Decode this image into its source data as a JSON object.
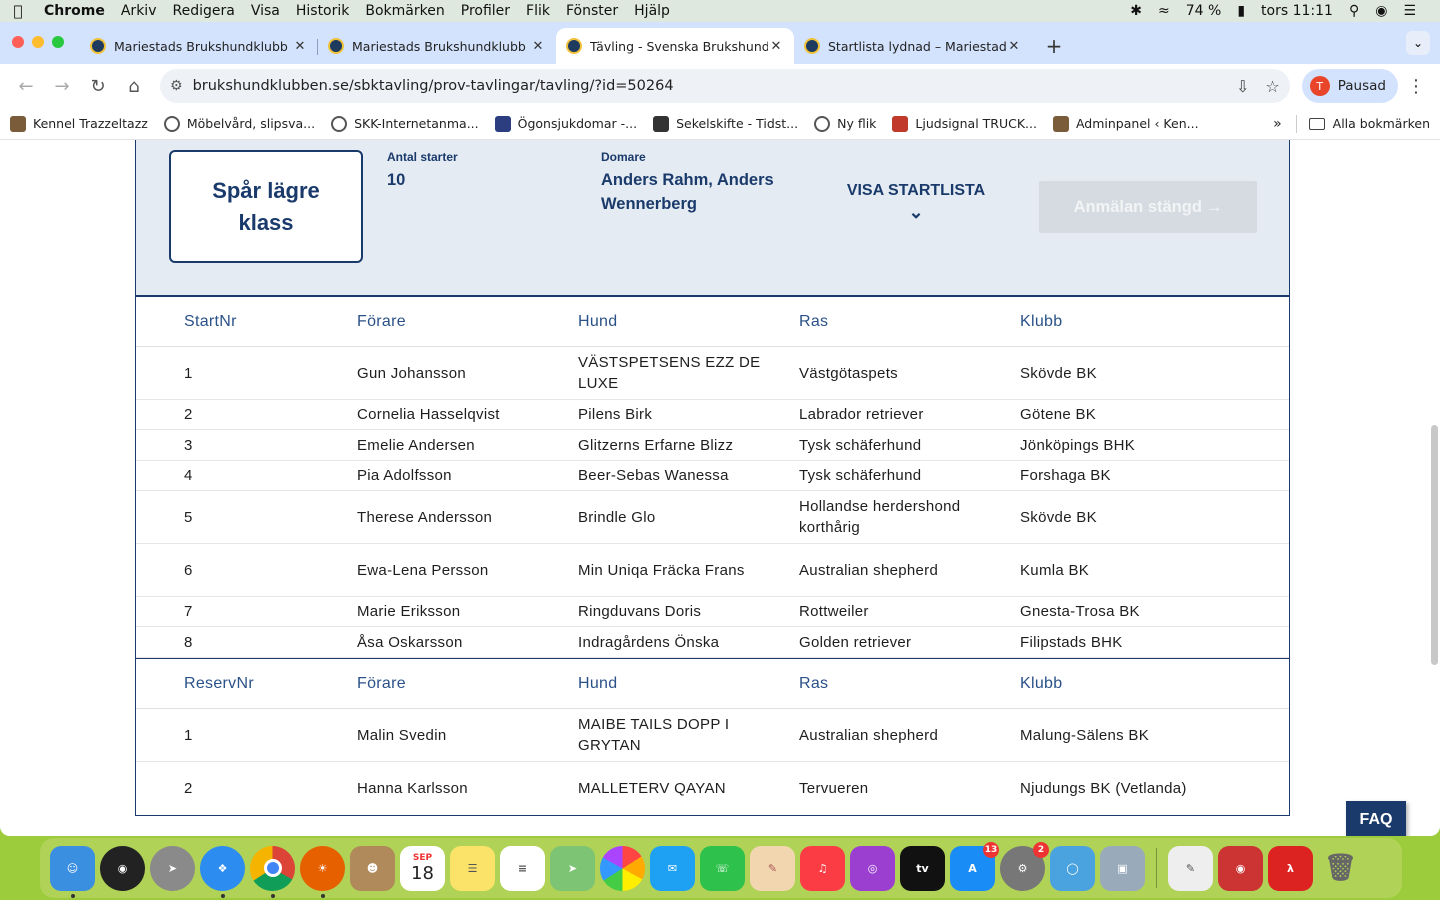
{
  "menubar": {
    "app": "Chrome",
    "items": [
      "Arkiv",
      "Redigera",
      "Visa",
      "Historik",
      "Bokmärken",
      "Profiler",
      "Flik",
      "Fönster",
      "Hjälp"
    ],
    "battery": "74 %",
    "clock": "tors 11:11"
  },
  "tabs": [
    {
      "title": "Mariestads Brukshundklubb –"
    },
    {
      "title": "Mariestads Brukshundklubb –"
    },
    {
      "title": "Tävling - Svenska Brukshund"
    },
    {
      "title": "Startlista lydnad – Mariestads"
    }
  ],
  "toolbar": {
    "url": "brukshundklubben.se/sbktavling/prov-tavlingar/tavling/?id=50264",
    "profile_initial": "T",
    "profile_label": "Pausad"
  },
  "bookmarks": {
    "items": [
      "Kennel Trazzeltazz",
      "Möbelvård, slipsva...",
      "SKK-Internetanma...",
      "Ögonsjukdomar -...",
      "Sekelskifte - Tidst...",
      "Ny flik",
      "Ljudsignal TRUCK...",
      "Adminpanel ‹ Ken..."
    ],
    "more": "»",
    "all": "Alla bokmärken"
  },
  "competition": {
    "class_name": "Spår lägre klass",
    "starts_label": "Antal starter",
    "starts_value": "10",
    "judge_label": "Domare",
    "judge_value": "Anders Rahm, Anders Wennerberg",
    "show_startlist": "VISA STARTLISTA",
    "signup_button": "Anmälan stängd"
  },
  "startlist": {
    "headers": [
      "StartNr",
      "Förare",
      "Hund",
      "Ras",
      "Klubb"
    ],
    "rows": [
      {
        "nr": "1",
        "handler": "Gun Johansson",
        "dog": "VÄSTSPETSENS EZZ DE LUXE",
        "breed": "Västgötaspets",
        "club": "Skövde BK"
      },
      {
        "nr": "2",
        "handler": "Cornelia Hasselqvist",
        "dog": "Pilens Birk",
        "breed": "Labrador retriever",
        "club": "Götene BK"
      },
      {
        "nr": "3",
        "handler": "Emelie Andersen",
        "dog": "Glitzerns Erfarne Blizz",
        "breed": "Tysk schäferhund",
        "club": "Jönköpings BHK"
      },
      {
        "nr": "4",
        "handler": "Pia Adolfsson",
        "dog": "Beer-Sebas Wanessa",
        "breed": "Tysk schäferhund",
        "club": "Forshaga BK"
      },
      {
        "nr": "5",
        "handler": "Therese Andersson",
        "dog": "Brindle Glo",
        "breed": "Hollandse herdershond korthårig",
        "club": "Skövde BK"
      },
      {
        "nr": "6",
        "handler": "Ewa-Lena Persson",
        "dog": "Min Uniqa Fräcka Frans",
        "breed": "Australian shepherd",
        "club": "Kumla BK"
      },
      {
        "nr": "7",
        "handler": "Marie Eriksson",
        "dog": "Ringduvans Doris",
        "breed": "Rottweiler",
        "club": "Gnesta-Trosa BK"
      },
      {
        "nr": "8",
        "handler": "Åsa Oskarsson",
        "dog": "Indragårdens Önska",
        "breed": "Golden retriever",
        "club": "Filipstads BHK"
      }
    ]
  },
  "reservelist": {
    "headers": [
      "ReservNr",
      "Förare",
      "Hund",
      "Ras",
      "Klubb"
    ],
    "rows": [
      {
        "nr": "1",
        "handler": "Malin Svedin",
        "dog": "MAIBE TAILS DOPP I GRYTAN",
        "breed": "Australian shepherd",
        "club": "Malung-Sälens BK"
      },
      {
        "nr": "2",
        "handler": "Hanna Karlsson",
        "dog": "MALLETERV QAYAN",
        "breed": "Tervueren",
        "club": "Njudungs BK (Vetlanda)"
      }
    ]
  },
  "faq": "FAQ",
  "dock": {
    "calendar_month": "SEP",
    "calendar_day": "18",
    "appstore_badge": "13",
    "settings_badge": "2"
  },
  "colors": {
    "brand_navy": "#1a3a6b",
    "header_blue": "#2a5188",
    "card_bg": "#e4ebf2",
    "tabstrip": "#d3e3fd"
  }
}
